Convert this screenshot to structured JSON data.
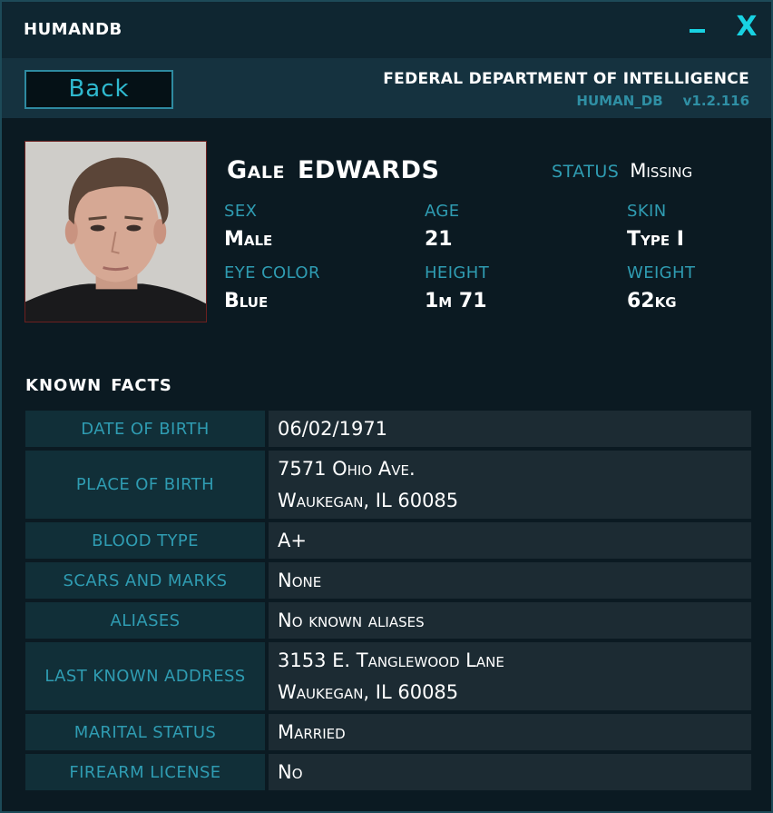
{
  "window": {
    "title": "HUMANDB",
    "minimize_icon": "minimize-icon",
    "close_icon": "close-icon",
    "close_glyph": "X",
    "accent_color": "#18d2e2"
  },
  "header": {
    "back_label": "Back",
    "agency": "FEDERAL DEPARTMENT OF INTELLIGENCE",
    "db_name": "HUMAN_DB",
    "version": "v1.2.116"
  },
  "profile": {
    "first_name": "Gale",
    "last_name": "EDWARDS",
    "status_label": "STATUS",
    "status_value": "Missing",
    "sex_label": "SEX",
    "sex_value": "Male",
    "age_label": "AGE",
    "age_value": "21",
    "skin_label": "SKIN",
    "skin_value": "Type I",
    "eye_label": "EYE COLOR",
    "eye_value": "Blue",
    "height_label": "HEIGHT",
    "height_value": "1m 71",
    "weight_label": "WEIGHT",
    "weight_value": "62kg"
  },
  "facts": {
    "title_1": "KNOWN",
    "title_2": "FACTS",
    "rows": [
      {
        "label": "DATE OF BIRTH",
        "lines": [
          "06/02/1971"
        ]
      },
      {
        "label": "PLACE OF BIRTH",
        "lines": [
          "7571 Ohio Ave.",
          "Waukegan, IL 60085"
        ]
      },
      {
        "label": "BLOOD TYPE",
        "lines": [
          "A+"
        ]
      },
      {
        "label": "SCARS AND MARKS",
        "lines": [
          "None"
        ]
      },
      {
        "label": "ALIASES",
        "lines": [
          "No known aliases"
        ]
      },
      {
        "label": "LAST KNOWN ADDRESS",
        "lines": [
          "3153 E. Tanglewood Lane",
          "Waukegan, IL 60085"
        ]
      },
      {
        "label": "MARITAL STATUS",
        "lines": [
          "Married"
        ]
      },
      {
        "label": "FIREARM LICENSE",
        "lines": [
          "No"
        ]
      }
    ]
  }
}
